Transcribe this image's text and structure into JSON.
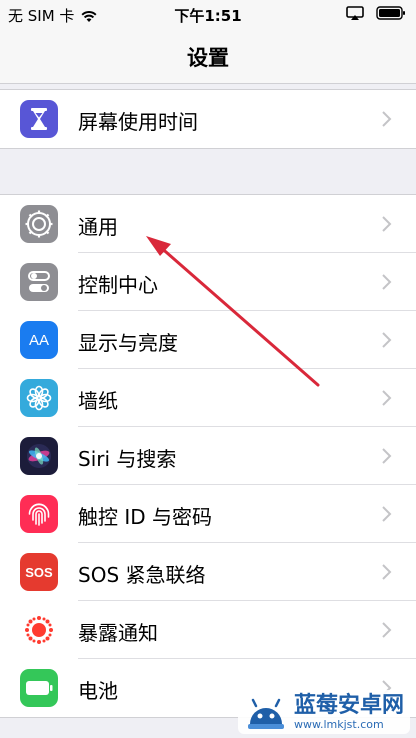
{
  "status": {
    "carrier": "无 SIM 卡",
    "time": "下午1:51"
  },
  "header": {
    "title": "设置"
  },
  "group1": [
    {
      "label": "屏幕使用时间",
      "icon": "hourglass-icon",
      "color": "#5856d6"
    }
  ],
  "group2": [
    {
      "label": "通用",
      "icon": "gear-icon",
      "color": "#8e8e93"
    },
    {
      "label": "控制中心",
      "icon": "toggle-switches-icon",
      "color": "#8e8e93"
    },
    {
      "label": "显示与亮度",
      "icon": "text-size-icon",
      "color": "#1a7cf0"
    },
    {
      "label": "墙纸",
      "icon": "flower-icon",
      "color": "#34aadc"
    },
    {
      "label": "Siri 与搜索",
      "icon": "siri-icon",
      "color": "#1c1c3a"
    },
    {
      "label": "触控 ID 与密码",
      "icon": "fingerprint-icon",
      "color": "#ff2d55"
    },
    {
      "label": "SOS 紧急联络",
      "icon": "sos-icon",
      "color": "#e53a2f"
    },
    {
      "label": "暴露通知",
      "icon": "exposure-icon",
      "color": "#ffffff"
    },
    {
      "label": "电池",
      "icon": "battery-icon",
      "color": "#34c759"
    }
  ],
  "sos_badge": "SOS",
  "text_size_badge": "AA",
  "watermark": {
    "title": "蓝莓安卓网",
    "url": "www.lmkjst.com"
  },
  "annotation_color": "#d9283a"
}
